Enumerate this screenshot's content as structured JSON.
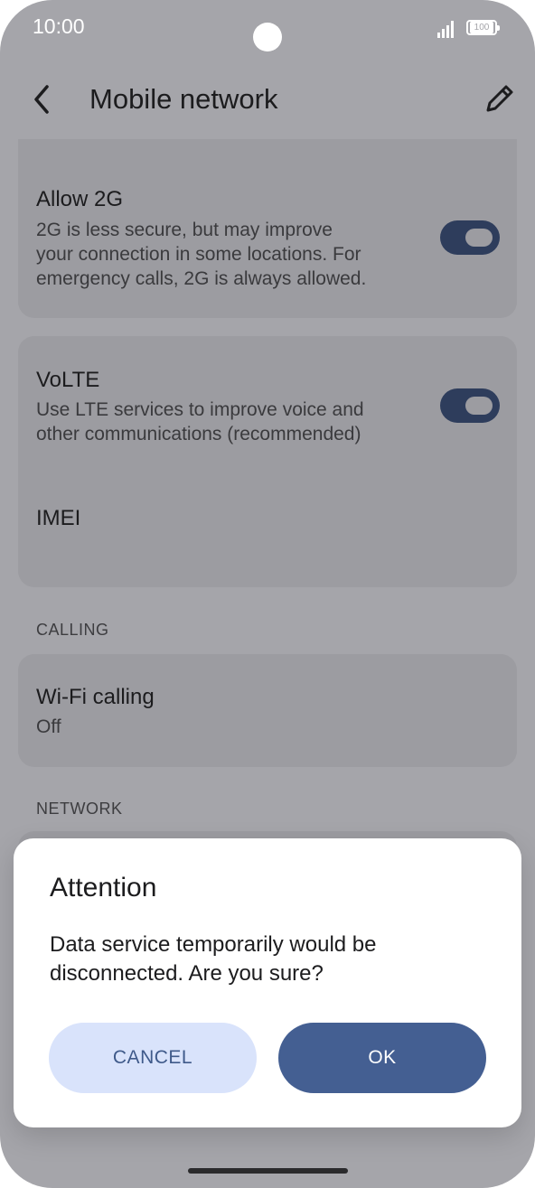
{
  "status_bar": {
    "time": "10:00",
    "battery": "100"
  },
  "app_bar": {
    "title": "Mobile network"
  },
  "settings": {
    "allow_2g": {
      "title": "Allow 2G",
      "subtitle_lines": [
        "2G is less secure, but may improve",
        "your connection in some locations. For",
        "emergency calls, 2G is always allowed."
      ],
      "enabled": true
    },
    "volte": {
      "title": "VoLTE",
      "subtitle_lines": [
        "Use LTE services to improve voice and",
        "other communications (recommended)"
      ],
      "enabled": true
    },
    "imei": {
      "title": "IMEI"
    },
    "calling_section": "CALLING",
    "wifi_calling": {
      "title": "Wi-Fi calling",
      "subtitle": "Off"
    },
    "network_section": "NETWORK"
  },
  "dialog": {
    "title": "Attention",
    "body_lines": [
      "Data service temporarily would be",
      "disconnected. Are you sure?"
    ],
    "cancel_label": "CANCEL",
    "ok_label": "OK"
  },
  "colors": {
    "toggle_on": "#2e3d5c",
    "ok_button": "#445f92",
    "cancel_button": "#d9e3fb"
  }
}
